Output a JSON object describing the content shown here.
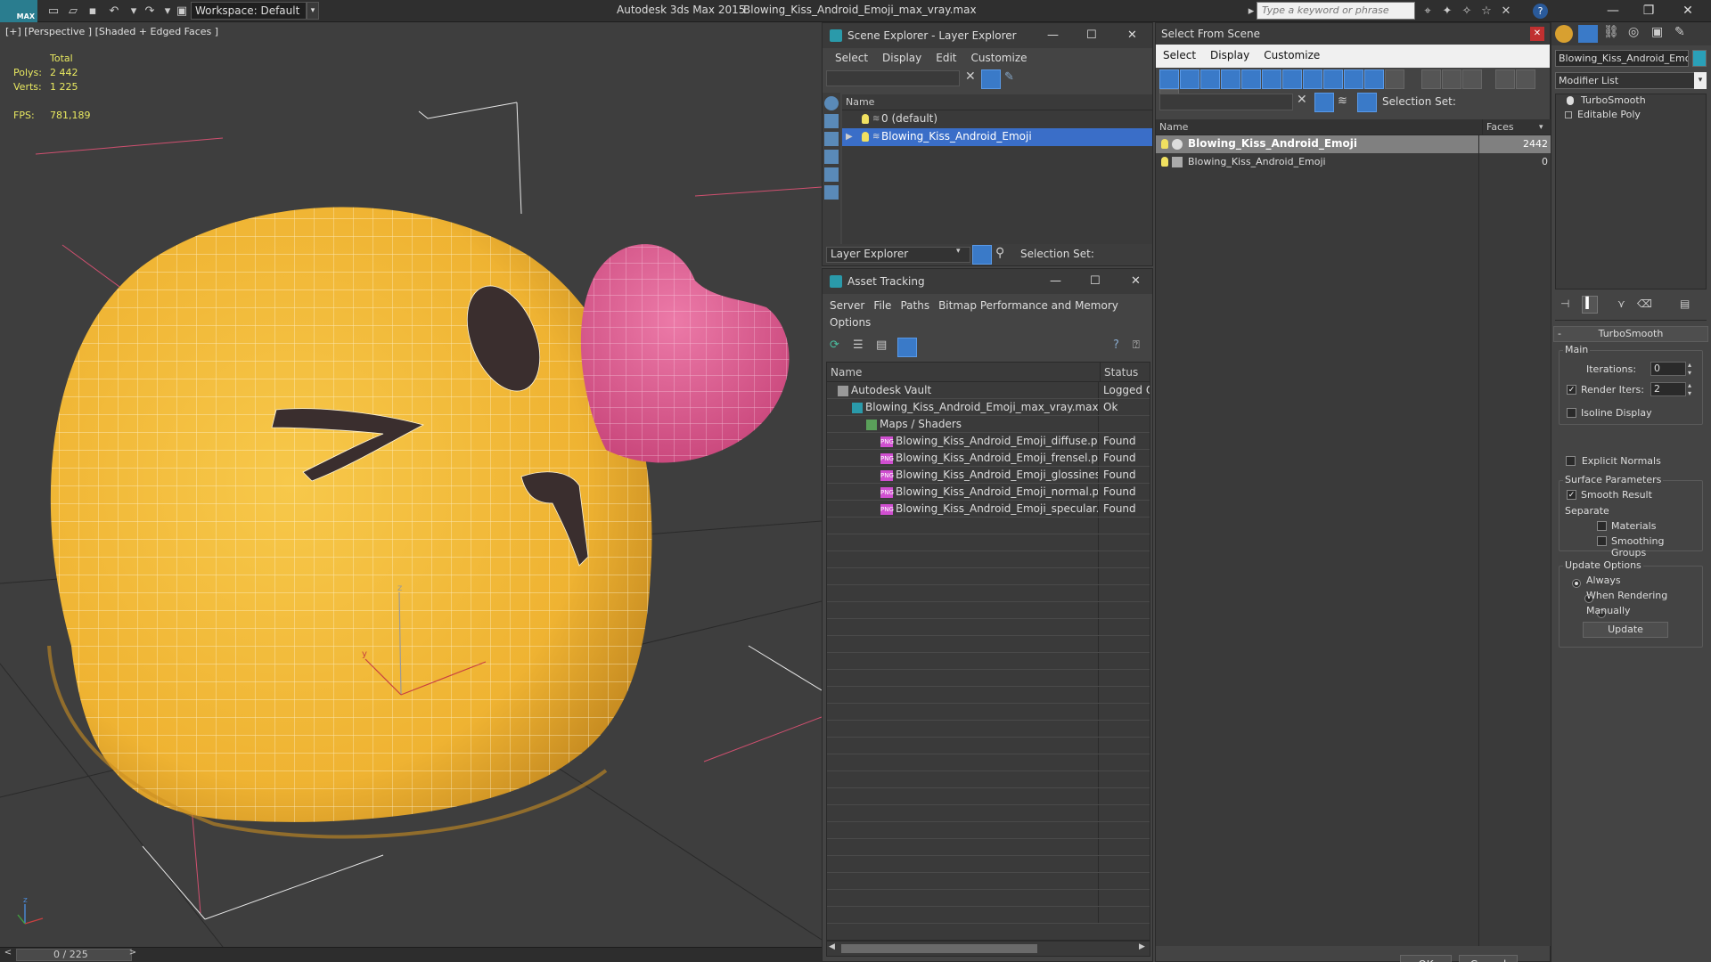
{
  "titlebar": {
    "logo": "MAX",
    "workspace": "Workspace: Default",
    "app_title": "Autodesk 3ds Max  2015",
    "file_title": "Blowing_Kiss_Android_Emoji_max_vray.max",
    "search_placeholder": "Type a keyword or phrase"
  },
  "viewport": {
    "label": "[+] [Perspective ] [Shaded + Edged Faces ]",
    "stats": {
      "total_label": "Total",
      "polys_label": "Polys:",
      "polys_value": "2 442",
      "verts_label": "Verts:",
      "verts_value": "1 225",
      "fps_label": "FPS:",
      "fps_value": "781,189"
    },
    "frame_counter": "0 / 225",
    "gizmo_axes": {
      "x": "x",
      "y": "y",
      "z": "z"
    }
  },
  "scene_explorer": {
    "title": "Scene Explorer - Layer Explorer",
    "menu": [
      "Select",
      "Display",
      "Edit",
      "Customize"
    ],
    "column_name": "Name",
    "rows": [
      {
        "label": "0 (default)",
        "selected": false
      },
      {
        "label": "Blowing_Kiss_Android_Emoji",
        "selected": true
      }
    ],
    "footer_dropdown": "Layer Explorer",
    "selection_set_label": "Selection Set:"
  },
  "asset_tracking": {
    "title": "Asset Tracking",
    "menu": [
      "Server",
      "File",
      "Paths",
      "Bitmap Performance and Memory"
    ],
    "menu2": "Options",
    "col_name": "Name",
    "col_status": "Status",
    "rows": [
      {
        "name": "Autodesk Vault",
        "status": "Logged Ou",
        "indent": 1,
        "icon": "vault"
      },
      {
        "name": "Blowing_Kiss_Android_Emoji_max_vray.max",
        "status": "Ok",
        "indent": 2,
        "icon": "max"
      },
      {
        "name": "Maps / Shaders",
        "status": "",
        "indent": 3,
        "icon": "maps"
      },
      {
        "name": "Blowing_Kiss_Android_Emoji_diffuse.p...",
        "status": "Found",
        "indent": 4,
        "icon": "png"
      },
      {
        "name": "Blowing_Kiss_Android_Emoji_frensel.p...",
        "status": "Found",
        "indent": 4,
        "icon": "png"
      },
      {
        "name": "Blowing_Kiss_Android_Emoji_glossines...",
        "status": "Found",
        "indent": 4,
        "icon": "png"
      },
      {
        "name": "Blowing_Kiss_Android_Emoji_normal.p...",
        "status": "Found",
        "indent": 4,
        "icon": "png"
      },
      {
        "name": "Blowing_Kiss_Android_Emoji_specular...",
        "status": "Found",
        "indent": 4,
        "icon": "png"
      }
    ],
    "png_icon_text": "PNG"
  },
  "select_from_scene": {
    "title": "Select From Scene",
    "menu": [
      "Select",
      "Display",
      "Customize"
    ],
    "selection_set_label": "Selection Set:",
    "col_name": "Name",
    "col_faces": "Faces",
    "rows": [
      {
        "name": "Blowing_Kiss_Android_Emoji",
        "faces": "2442",
        "selected": true
      },
      {
        "name": "Blowing_Kiss_Android_Emoji",
        "faces": "0",
        "selected": false
      }
    ],
    "ok_label": "OK",
    "cancel_label": "Cancel"
  },
  "command_panel": {
    "object_name": "Blowing_Kiss_Android_Emoji",
    "modifier_list": "Modifier List",
    "stack": [
      "TurboSmooth",
      "Editable Poly"
    ],
    "rollout_title": "TurboSmooth",
    "main_label": "Main",
    "iterations_label": "Iterations:",
    "iterations_value": "0",
    "render_iters_label": "Render Iters:",
    "render_iters_value": "2",
    "render_iters_checked": true,
    "isoline_label": "Isoline Display",
    "explicit_normals_label": "Explicit Normals",
    "surface_label": "Surface Parameters",
    "smooth_result_label": "Smooth Result",
    "separate_label": "Separate",
    "materials_label": "Materials",
    "smoothing_groups_label": "Smoothing Groups",
    "update_options_label": "Update Options",
    "always_label": "Always",
    "when_rendering_label": "When Rendering",
    "manually_label": "Manually",
    "update_button": "Update"
  },
  "colors": {
    "emoji_yellow": "#f3b73a",
    "heart_pink": "#e05f95",
    "selection_blue": "#3a6ec8",
    "stat_yellow": "#e8e860"
  }
}
